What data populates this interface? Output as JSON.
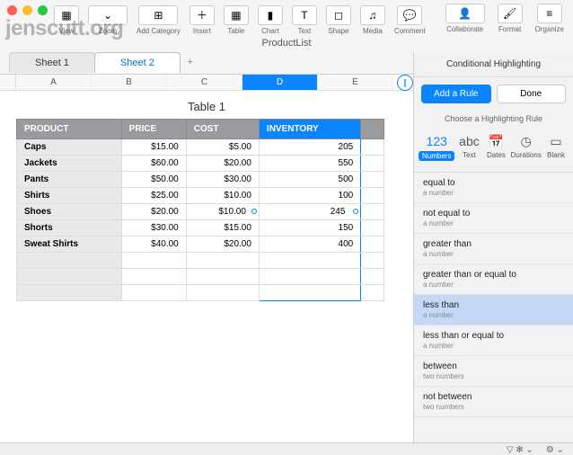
{
  "watermark": "jenscutt.org",
  "window_controls": [
    "close",
    "minimize",
    "zoom"
  ],
  "toolbar": {
    "view_label": "View",
    "zoom_label": "Zoom",
    "addcat_label": "Add Category",
    "insert_label": "Insert",
    "table_label": "Table",
    "chart_label": "Chart",
    "text_label": "Text",
    "shape_label": "Shape",
    "media_label": "Media",
    "comment_label": "Comment",
    "collaborate_label": "Collaborate",
    "format_label": "Format",
    "organize_label": "Organize"
  },
  "document_title": "ProductList",
  "sheets": {
    "tab1": "Sheet 1",
    "tab2": "Sheet 2",
    "add": "+"
  },
  "columns": {
    "a": "A",
    "b": "B",
    "c": "C",
    "d": "D",
    "e": "E"
  },
  "table": {
    "title": "Table 1",
    "headers": {
      "product": "PRODUCT",
      "price": "PRICE",
      "cost": "COST",
      "inventory": "INVENTORY"
    },
    "rows": [
      {
        "product": "Caps",
        "price": "$15.00",
        "cost": "$5.00",
        "inventory": "205"
      },
      {
        "product": "Jackets",
        "price": "$60.00",
        "cost": "$20.00",
        "inventory": "550"
      },
      {
        "product": "Pants",
        "price": "$50.00",
        "cost": "$30.00",
        "inventory": "500"
      },
      {
        "product": "Shirts",
        "price": "$25.00",
        "cost": "$10.00",
        "inventory": "100"
      },
      {
        "product": "Shoes",
        "price": "$20.00",
        "cost": "$10.00",
        "inventory": "245"
      },
      {
        "product": "Shorts",
        "price": "$30.00",
        "cost": "$15.00",
        "inventory": "150"
      },
      {
        "product": "Sweat Shirts",
        "price": "$40.00",
        "cost": "$20.00",
        "inventory": "400"
      }
    ]
  },
  "inspector": {
    "title": "Conditional Highlighting",
    "add_rule": "Add a Rule",
    "done": "Done",
    "choose": "Choose a Highlighting Rule",
    "types": {
      "numbers": {
        "icon": "123",
        "label": "Numbers"
      },
      "text": {
        "icon": "abc",
        "label": "Text"
      },
      "dates": {
        "icon": "📅",
        "label": "Dates"
      },
      "durations": {
        "icon": "◷",
        "label": "Durations"
      },
      "blank": {
        "icon": "▭",
        "label": "Blank"
      }
    },
    "rules": [
      {
        "name": "equal to",
        "sub": "a number"
      },
      {
        "name": "not equal to",
        "sub": "a number"
      },
      {
        "name": "greater than",
        "sub": "a number"
      },
      {
        "name": "greater than or equal to",
        "sub": "a number"
      },
      {
        "name": "less than",
        "sub": "a number"
      },
      {
        "name": "less than or equal to",
        "sub": "a number"
      },
      {
        "name": "between",
        "sub": "two numbers"
      },
      {
        "name": "not between",
        "sub": "two numbers"
      }
    ]
  }
}
